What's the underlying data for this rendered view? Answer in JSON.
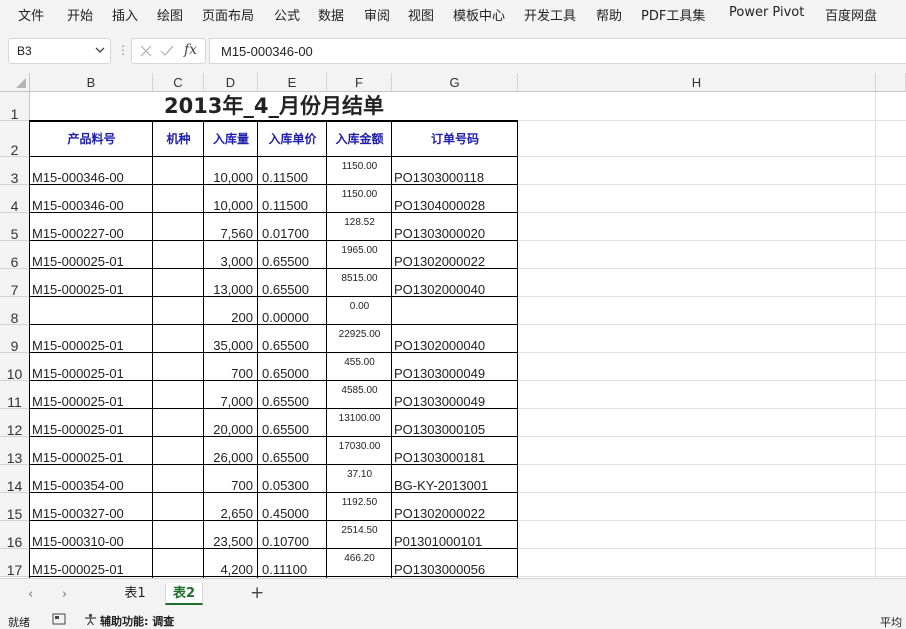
{
  "menu": [
    "文件",
    "开始",
    "插入",
    "绘图",
    "页面布局",
    "公式",
    "数据",
    "审阅",
    "视图",
    "模板中心",
    "开发工具",
    "帮助",
    "PDF工具集",
    "Power Pivot",
    "百度网盘"
  ],
  "formula_bar": {
    "name_box": "B3",
    "fx_label": "fx",
    "value": "M15-000346-00"
  },
  "columns": [
    "B",
    "C",
    "D",
    "E",
    "F",
    "G",
    "H"
  ],
  "rows": [
    "1",
    "2",
    "3",
    "4",
    "5",
    "6",
    "7",
    "8",
    "9",
    "10",
    "11",
    "12",
    "13",
    "14",
    "15",
    "16",
    "17"
  ],
  "sheet": {
    "title": "2013年_4_月份月结单",
    "headers": [
      "产品料号",
      "机种",
      "入库量",
      "入库单价",
      "入库金额",
      "订单号码"
    ],
    "records": [
      [
        "M15-000346-00",
        "",
        "10,000",
        "0.11500",
        "1150.00",
        "PO1303000118"
      ],
      [
        "M15-000346-00",
        "",
        "10,000",
        "0.11500",
        "1150.00",
        "PO1304000028"
      ],
      [
        "M15-000227-00",
        "",
        "7,560",
        "0.01700",
        "128.52",
        "PO1303000020"
      ],
      [
        "M15-000025-01",
        "",
        "3,000",
        "0.65500",
        "1965.00",
        "PO1302000022"
      ],
      [
        "M15-000025-01",
        "",
        "13,000",
        "0.65500",
        "8515.00",
        "PO1302000040"
      ],
      [
        "",
        "",
        "200",
        "0.00000",
        "0.00",
        ""
      ],
      [
        "M15-000025-01",
        "",
        "35,000",
        "0.65500",
        "22925.00",
        "PO1302000040"
      ],
      [
        "M15-000025-01",
        "",
        "700",
        "0.65000",
        "455.00",
        "PO1303000049"
      ],
      [
        "M15-000025-01",
        "",
        "7,000",
        "0.65500",
        "4585.00",
        "PO1303000049"
      ],
      [
        "M15-000025-01",
        "",
        "20,000",
        "0.65500",
        "13100.00",
        "PO1303000105"
      ],
      [
        "M15-000025-01",
        "",
        "26,000",
        "0.65500",
        "17030.00",
        "PO1303000181"
      ],
      [
        "M15-000354-00",
        "",
        "700",
        "0.05300",
        "37.10",
        "BG-KY-2013001"
      ],
      [
        "M15-000327-00",
        "",
        "2,650",
        "0.45000",
        "1192.50",
        "PO1302000022"
      ],
      [
        "M15-000310-00",
        "",
        "23,500",
        "0.10700",
        "2514.50",
        "P01301000101"
      ],
      [
        "M15-000025-01",
        "",
        "4,200",
        "0.11100",
        "466.20",
        "PO1303000056"
      ]
    ]
  },
  "tabs": {
    "sheets": [
      "表1",
      "表2"
    ],
    "active": "表2",
    "prev": "‹",
    "next": "›",
    "add": "+"
  },
  "status": {
    "ready": "就绪",
    "accessibility": "辅助功能: 调查",
    "average": "平均"
  },
  "colors": {
    "header_text": "#1f1fb0",
    "active_tab": "#1f6e2a",
    "gridline": "#e1e1e1"
  }
}
